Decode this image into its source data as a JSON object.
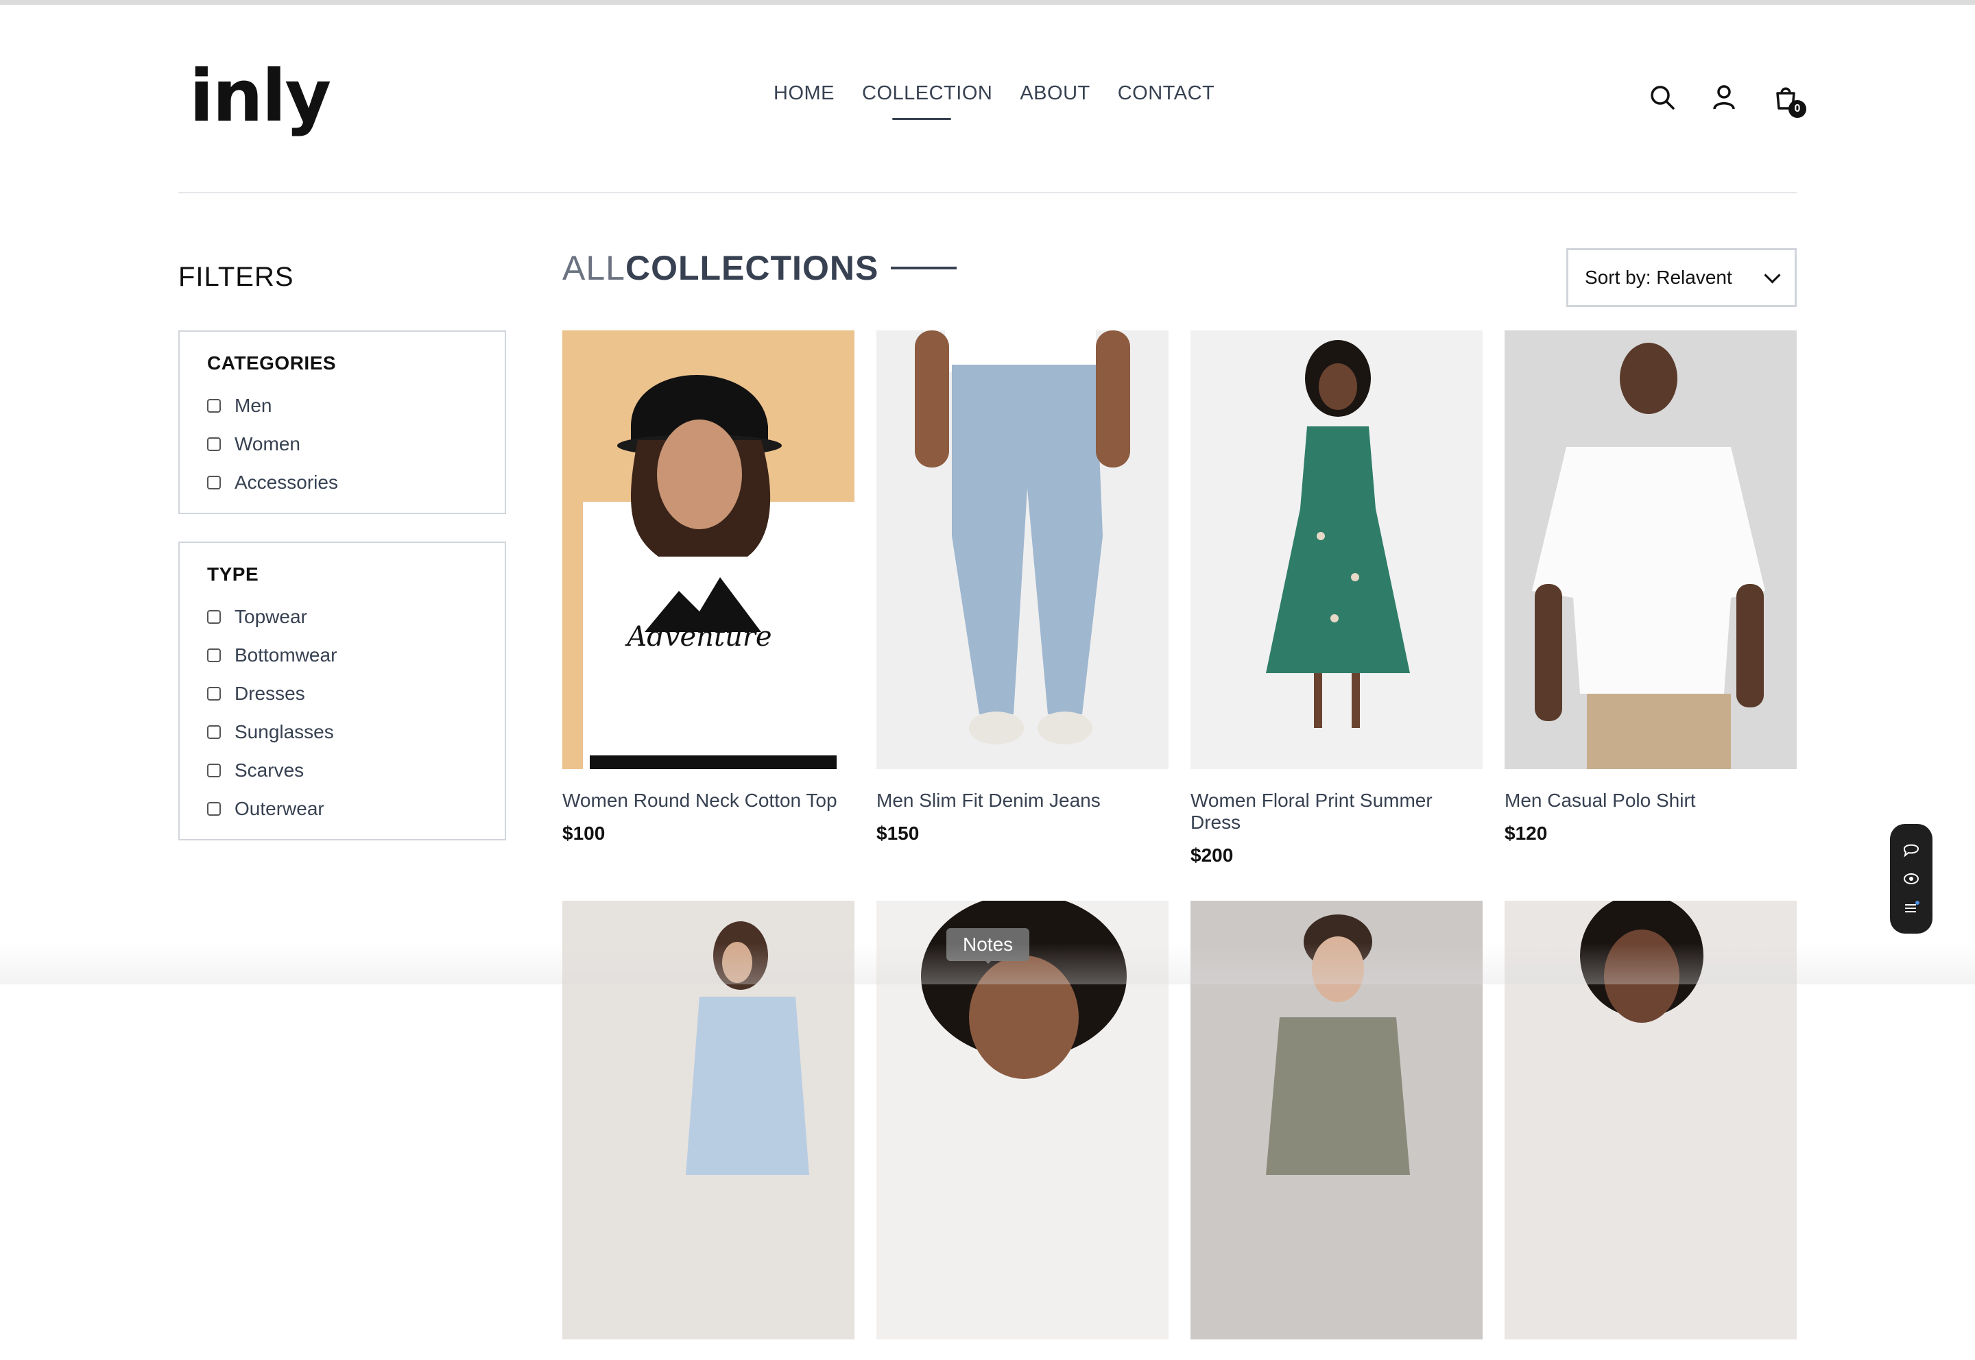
{
  "brand": {
    "logo_text": "inly"
  },
  "nav": {
    "items": [
      {
        "label": "HOME",
        "active": false
      },
      {
        "label": "COLLECTION",
        "active": true
      },
      {
        "label": "ABOUT",
        "active": false
      },
      {
        "label": "CONTACT",
        "active": false
      }
    ]
  },
  "header": {
    "icons": [
      "search-icon",
      "user-icon",
      "cart-icon"
    ],
    "cart_count": "0"
  },
  "filters": {
    "title": "FILTERS",
    "categories": {
      "heading": "CATEGORIES",
      "options": [
        "Men",
        "Women",
        "Accessories"
      ]
    },
    "type": {
      "heading": "TYPE",
      "options": [
        "Topwear",
        "Bottomwear",
        "Dresses",
        "Sunglasses",
        "Scarves",
        "Outerwear"
      ]
    }
  },
  "main": {
    "title_light": "ALL",
    "title_dark": "COLLECTIONS",
    "sort": {
      "selected": "Sort by: Relavent"
    },
    "products": [
      {
        "name": "Women Round Neck Cotton Top",
        "price": "$100"
      },
      {
        "name": "Men Slim Fit Denim Jeans",
        "price": "$150"
      },
      {
        "name": "Women Floral Print Summer Dress",
        "price": "$200"
      },
      {
        "name": "Men Casual Polo Shirt",
        "price": "$120"
      },
      {
        "name": "",
        "price": ""
      },
      {
        "name": "",
        "price": ""
      },
      {
        "name": "",
        "price": ""
      },
      {
        "name": "",
        "price": ""
      }
    ]
  },
  "overlay": {
    "tooltip": "Notes",
    "toolbar_icons": [
      "chat-icon",
      "eye-icon",
      "list-icon"
    ]
  },
  "colors": {
    "accent": "#374151",
    "tshirt_bg": "#ecc28d",
    "toolbar_bg": "#1f1f1f"
  }
}
